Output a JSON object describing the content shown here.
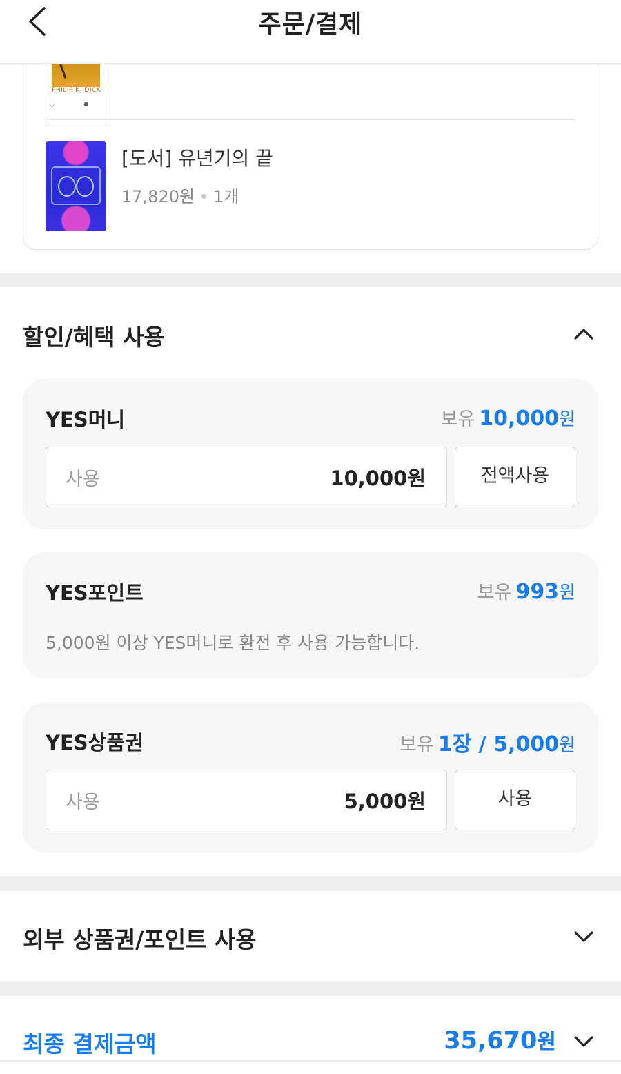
{
  "header": {
    "title": "주문/결제"
  },
  "order_items": [
    {
      "author_text": "PHILIP K. DICK"
    },
    {
      "title": "[도서] 유년기의 끝",
      "price": "17,820원",
      "qty": "1개"
    }
  ],
  "benefits": {
    "title": "할인/혜택 사용",
    "yes_money": {
      "label": "YES머니",
      "own_prefix": "보유",
      "own_amount": "10,000",
      "own_unit": "원",
      "input_placeholder": "사용",
      "input_value": "10,000원",
      "button": "전액사용"
    },
    "yes_point": {
      "label": "YES포인트",
      "own_prefix": "보유",
      "own_amount": "993",
      "own_unit": "원",
      "note": "5,000원 이상 YES머니로 환전 후 사용 가능합니다."
    },
    "yes_giftcard": {
      "label": "YES상품권",
      "own_prefix": "보유",
      "own_amount": "1장 / 5,000",
      "own_unit": "원",
      "input_placeholder": "사용",
      "input_value": "5,000원",
      "button": "사용"
    }
  },
  "external": {
    "title": "외부 상품권/포인트 사용"
  },
  "final": {
    "label": "최종 결제금액",
    "amount": "35,670",
    "unit": "원"
  },
  "colors": {
    "accent": "#1a7ce8",
    "panel_bg": "#f6f6f6",
    "divider_bg": "#efefef"
  }
}
